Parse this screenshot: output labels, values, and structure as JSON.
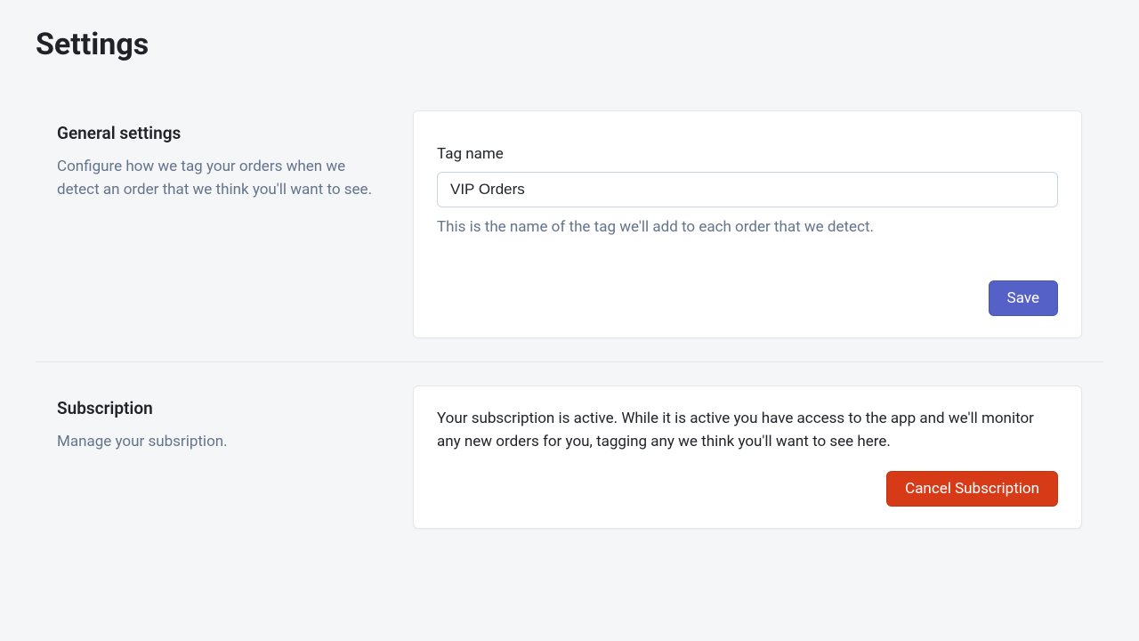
{
  "page": {
    "title": "Settings"
  },
  "general": {
    "heading": "General settings",
    "description": "Configure how we tag your orders when we detect an order that we think you'll want to see.",
    "tag_name_label": "Tag name",
    "tag_name_value": "VIP Orders",
    "tag_name_help": "This is the name of the tag we'll add to each order that we detect.",
    "save_label": "Save"
  },
  "subscription": {
    "heading": "Subscription",
    "description": "Manage your subsription.",
    "status_text": "Your subscription is active. While it is active you have access to the app and we'll monitor any new orders for you, tagging any we think you'll want to see here.",
    "cancel_label": "Cancel Subscription"
  }
}
